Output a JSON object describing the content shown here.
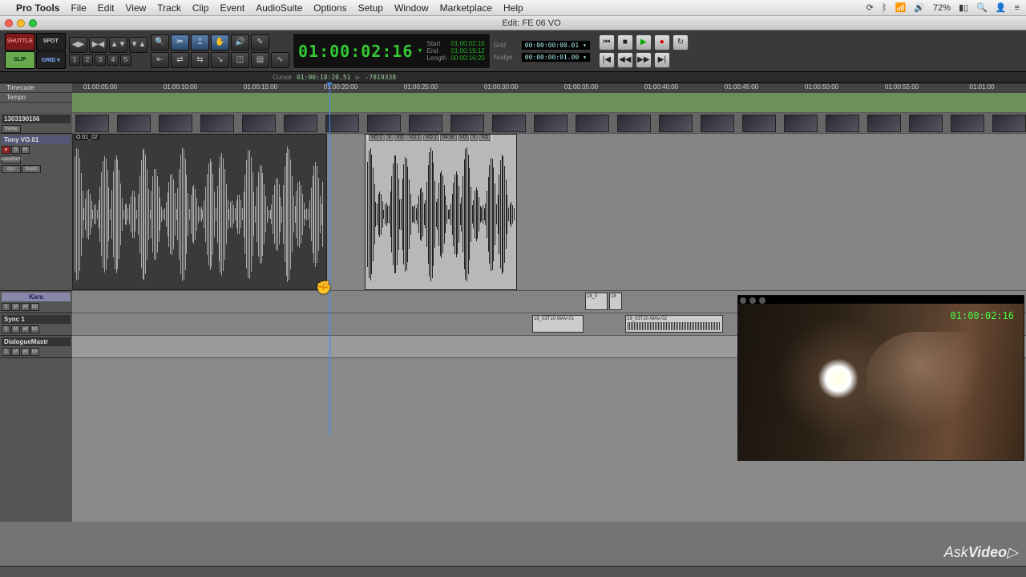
{
  "menubar": {
    "apple": "",
    "app": "Pro Tools",
    "items": [
      "File",
      "Edit",
      "View",
      "Track",
      "Clip",
      "Event",
      "AudioSuite",
      "Options",
      "Setup",
      "Window",
      "Marketplace",
      "Help"
    ]
  },
  "sys": {
    "battery_pct": "72%",
    "search_icon": "🔍",
    "user_icon": "👤",
    "menu_icon": "≡"
  },
  "window": {
    "title": "Edit: FE 06 VO"
  },
  "modes": {
    "shuttle": "SHUTTLE",
    "spot": "SPOT",
    "slip": "SLIP",
    "grid": "GRID ▾"
  },
  "zoom_presets": [
    "1",
    "2",
    "3",
    "4",
    "5"
  ],
  "counter": {
    "main": "01:00:02:16",
    "start_lbl": "Start",
    "start": "01:00:02:16",
    "end_lbl": "End",
    "end": "01:00:19:12",
    "len_lbl": "Length",
    "len": "00:00:16:20"
  },
  "gridnudge": {
    "grid_lbl": "Grid",
    "grid": "00:00:00:00.01 ▾",
    "nudge_lbl": "Nudge",
    "nudge": "00:00:00:01.00 ▾"
  },
  "cursorbar": {
    "lbl": "Cursor",
    "val": "01:00:18:20.51",
    "samples": "-7819338"
  },
  "ruler": {
    "rows": [
      "Timecode",
      "Tempo"
    ],
    "marks": [
      "01:00:05:00",
      "01:00:10:00",
      "01:00:15:00",
      "01:00:20:00",
      "01:00:25:00",
      "01:00:30:00",
      "01:00:35:00",
      "01:00:40:00",
      "01:00:45:00",
      "01:00:50:00",
      "01:00:55:00",
      "01:01:00"
    ]
  },
  "tracks": {
    "video": {
      "name": "1303190106",
      "frame_label": "frame"
    },
    "vo": {
      "name": "Tony VO.01",
      "clip1": "O.01_02",
      "clip2_labels": [
        "VO 1",
        "V",
        "VO",
        "VO 1",
        "VO 1",
        "04:36",
        "VO",
        "V",
        "VO"
      ],
      "view": "waveform",
      "dyn": "dyn",
      "touch": "touch"
    },
    "kara": {
      "name": "Kara",
      "clip_labels": [
        "18_0",
        "18"
      ]
    },
    "sync": {
      "name": "Sync 1",
      "clips": [
        "19_03T10.WAV-01",
        "19_03T20.WAV-02"
      ]
    },
    "dlg": {
      "name": "DialogueMastr"
    },
    "ctrl": {
      "rec": "●",
      "s": "S",
      "m": "M",
      "wf": "wf",
      "tch": "tch"
    }
  },
  "video_overlay": {
    "tc": "01:00:02:16"
  },
  "branding": {
    "ask": "Ask",
    "video": "Video"
  },
  "chart_data": {
    "type": "table",
    "note": "DAW edit window; no chart data"
  }
}
